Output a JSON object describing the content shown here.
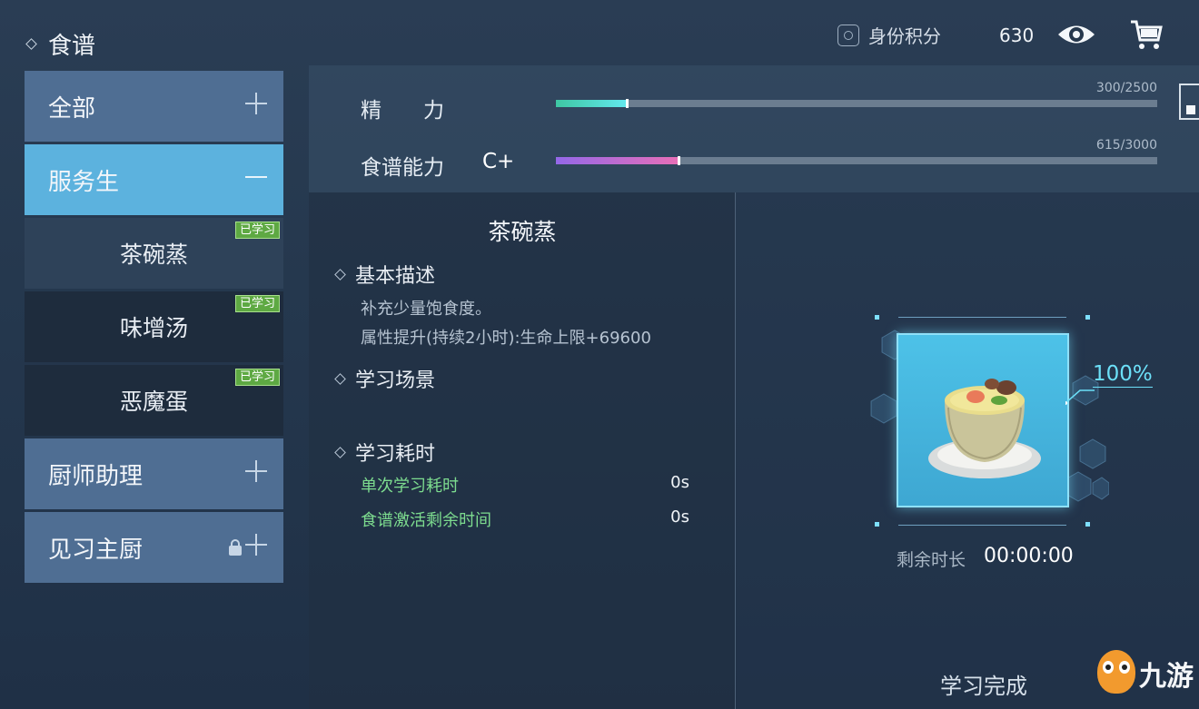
{
  "header": {
    "title": "食谱",
    "identity_points_label": "身份积分",
    "identity_points_value": "630"
  },
  "sidebar": {
    "categories": [
      {
        "label": "全部",
        "state": "collapsed"
      },
      {
        "label": "服务生",
        "state": "expanded"
      },
      {
        "label": "厨师助理",
        "state": "collapsed"
      },
      {
        "label": "见习主厨",
        "state": "locked"
      }
    ],
    "recipes": [
      {
        "label": "茶碗蒸",
        "tag": "已学习"
      },
      {
        "label": "味增汤",
        "tag": "已学习"
      },
      {
        "label": "恶魔蛋",
        "tag": "已学习"
      }
    ]
  },
  "stats": {
    "energy": {
      "label": "精　　力",
      "value_text": "300/2500",
      "fraction": 0.12
    },
    "recipe_ability": {
      "label": "食谱能力",
      "grade": "C+",
      "value_text": "615/3000",
      "fraction": 0.205
    }
  },
  "detail": {
    "dish_name": "茶碗蒸",
    "basic_desc_heading": "基本描述",
    "desc_line1": "补充少量饱食度。",
    "desc_line2": "属性提升(持续2小时):生命上限+69600",
    "scene_heading": "学习场景",
    "time_heading": "学习耗时",
    "single_time_label": "单次学习耗时",
    "single_time_value": "0s",
    "activation_label": "食谱激活剩余时间",
    "activation_value": "0s"
  },
  "preview": {
    "progress_text": "100%",
    "remaining_label": "剩余时长",
    "remaining_value": "00:00:00",
    "status": "学习完成"
  },
  "watermark": {
    "text": "九游"
  },
  "colors": {
    "selected_category": "#5cb2de",
    "learned_tag": "#5ea943",
    "energy_bar": "#63e8ee",
    "ability_bar": "#e86fb7",
    "progress_text": "#6ce0f8"
  },
  "icons": [
    "diamond-icon",
    "identity-icon",
    "eye-icon",
    "cart-icon",
    "plus-icon",
    "minus-icon",
    "lock-icon"
  ]
}
